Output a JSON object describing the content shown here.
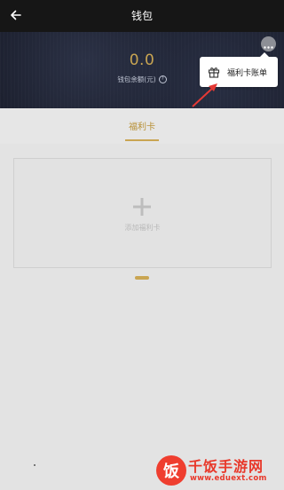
{
  "header": {
    "title": "钱包",
    "back_icon": "back-arrow-icon"
  },
  "wallet": {
    "balance": "0.0",
    "balance_label": "钱包余额(元)",
    "help_glyph": "?",
    "more_icon": "more-dots-icon"
  },
  "popover": {
    "item_label": "福利卡账单",
    "item_icon": "gift-icon"
  },
  "tabs": [
    {
      "label": "福利卡",
      "active": true
    }
  ],
  "add_card": {
    "label": "添加福利卡",
    "icon": "plus-icon"
  },
  "watermark": {
    "logo_glyph": "饭",
    "title": "千饭手游网",
    "url": "www.eduext.com"
  },
  "colors": {
    "accent_gold": "#c9a552",
    "annotation_red": "#e53935",
    "header_bg": "#161616",
    "hero_bg": "#1d2130"
  }
}
